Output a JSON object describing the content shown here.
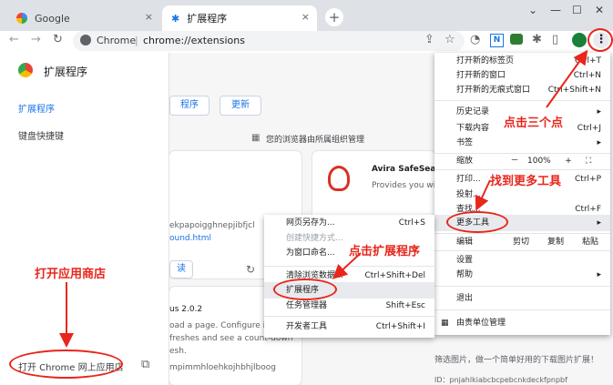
{
  "tabs": [
    {
      "label": "Google",
      "close": "×"
    },
    {
      "label": "扩展程序",
      "close": "×"
    }
  ],
  "new_tab_label": "+",
  "window_controls": {
    "dropdown": "⌄",
    "minimize": "—",
    "maximize": "☐",
    "close": "✕"
  },
  "address": {
    "site": "Chrome",
    "divider": "|",
    "url": "chrome://extensions"
  },
  "sidebar": {
    "title": "扩展程序",
    "items": [
      {
        "label": "扩展程序",
        "active": true
      },
      {
        "label": "键盘快捷键",
        "active": false
      }
    ],
    "store_link": "打开 Chrome 网上应用店"
  },
  "main": {
    "pack_button": "程序",
    "update_button": "更新",
    "managed_notice": "您的浏览器由所属组织管理",
    "ext1_id_partial": "ekpapoigghnepjibfjcl",
    "ext1_link_partial": "ound.html",
    "ext1_details_partial": "读",
    "ext2_version_partial": "us 2.0.2",
    "ext2_desc": [
      "oad a page. Configure inte",
      "freshes and see a count-down",
      "esh."
    ],
    "ext2_id_partial": "mpimmhloehkojhbhjlboog",
    "avira_title": "Avira SafeSearc",
    "avira_desc": "Provides you wi",
    "bottom_text": "筛选图片，做一个简单好用的下载图片扩展！",
    "bottom_id": "ID：pnjahlkiabcbcpebcnkdeckfpnpbf"
  },
  "chrome_menu": {
    "items": [
      {
        "label": "打开新的标签页",
        "shortcut": "Ctrl+T"
      },
      {
        "label": "打开新的窗口",
        "shortcut": "Ctrl+N"
      },
      {
        "label": "打开新的无痕式窗口",
        "shortcut": "Ctrl+Shift+N"
      },
      {
        "label": "历史记录",
        "shortcut": "▸"
      },
      {
        "label": "下载内容",
        "shortcut": "Ctrl+J"
      },
      {
        "label": "书签",
        "shortcut": "▸"
      },
      {
        "label": "缩放",
        "zoom_minus": "－",
        "zoom_value": "100%",
        "zoom_plus": "+",
        "fullscreen": "⛶"
      },
      {
        "label": "打印...",
        "shortcut": "Ctrl+P"
      },
      {
        "label": "投射...",
        "shortcut": ""
      },
      {
        "label": "查找...",
        "shortcut": "Ctrl+F"
      },
      {
        "label": "更多工具",
        "shortcut": "▸"
      },
      {
        "label": "编辑",
        "cut": "剪切",
        "copy": "复制",
        "paste": "粘贴"
      },
      {
        "label": "设置",
        "shortcut": ""
      },
      {
        "label": "帮助",
        "shortcut": "▸"
      },
      {
        "label": "退出",
        "shortcut": ""
      },
      {
        "label": "由贵单位管理",
        "shortcut": ""
      }
    ]
  },
  "more_tools_menu": {
    "items": [
      {
        "label": "网页另存为...",
        "shortcut": "Ctrl+S"
      },
      {
        "label": "创建快捷方式...",
        "shortcut": ""
      },
      {
        "label": "为窗口命名...",
        "shortcut": ""
      },
      {
        "label": "清除浏览数据...",
        "shortcut": "Ctrl+Shift+Del"
      },
      {
        "label": "扩展程序",
        "shortcut": ""
      },
      {
        "label": "任务管理器",
        "shortcut": "Shift+Esc"
      },
      {
        "label": "开发者工具",
        "shortcut": "Ctrl+Shift+I"
      }
    ]
  },
  "annotations": {
    "three_dots": "点击三个点",
    "more_tools": "找到更多工具",
    "extensions": "点击扩展程序",
    "open_store": "打开应用商店"
  },
  "colors": {
    "accent": "#1a73e8",
    "annotation": "#e8261c"
  }
}
